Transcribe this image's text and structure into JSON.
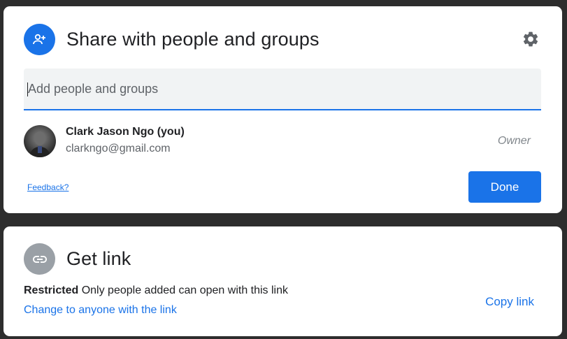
{
  "share": {
    "title": "Share with people and groups",
    "header_icon": "person-add-icon",
    "settings_icon": "gear-icon",
    "input_placeholder": "Add people and groups",
    "user": {
      "name": "Clark Jason Ngo (you)",
      "email": "clarkngo@gmail.com",
      "role": "Owner"
    },
    "feedback_label": "Feedback?",
    "done_label": "Done"
  },
  "link": {
    "title": "Get link",
    "header_icon": "link-icon",
    "restriction_label": "Restricted",
    "restriction_desc": "Only people added can open with this link",
    "change_label": "Change to anyone with the link",
    "copy_label": "Copy link"
  },
  "colors": {
    "accent": "#1a73e8",
    "background": "#2d2d2d",
    "link_icon_bg": "#9aa0a6"
  }
}
